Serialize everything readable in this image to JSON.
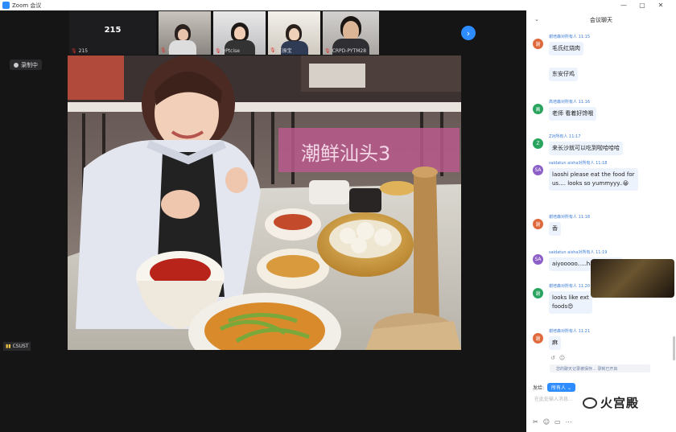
{
  "window": {
    "app_name": "Zoom 会议",
    "minimize": "—",
    "maximize": "▢",
    "close": "✕"
  },
  "recording": {
    "label": "录制中"
  },
  "thumbnails": [
    {
      "type": "number",
      "value": "215",
      "name": "215"
    },
    {
      "type": "person",
      "name": "金属选"
    },
    {
      "type": "person",
      "name": "yPtcise"
    },
    {
      "type": "person",
      "name": "王振宝"
    },
    {
      "type": "person",
      "name": "CRPD-PYTM28"
    }
  ],
  "main_video": {
    "speaker_name": "CSUST",
    "sign_text": "潮鲜汕头3"
  },
  "chat": {
    "title": "会议聊天",
    "messages": [
      {
        "avatar": "谢",
        "avatar_color": "#e0693c",
        "meta": "谢培森对所有人 11:15",
        "lines": [
          "毛氏红烧肉"
        ]
      },
      {
        "avatar": "",
        "avatar_color": "",
        "meta": "",
        "lines": [
          "东安仔鸡"
        ]
      },
      {
        "avatar": "高",
        "avatar_color": "#28a45e",
        "meta": "高培森对所有人 11:16",
        "lines": [
          "老师 看着好馋哦"
        ]
      },
      {
        "avatar": "Z",
        "avatar_color": "#28a45e",
        "meta": "Z对所有人 11:17",
        "lines": [
          "来长沙就可以吃到啦哈哈哈"
        ]
      },
      {
        "avatar": "SA",
        "avatar_color": "#8b5ec8",
        "meta": "saidatun aisha对所有人 11:18",
        "lines": [
          "laoshi please eat the food for",
          "us.... looks so yummyyy..😀"
        ]
      },
      {
        "avatar": "谢",
        "avatar_color": "#e0693c",
        "meta": "谢培森对所有人 11:18",
        "lines": [
          "香"
        ]
      },
      {
        "avatar": "SA",
        "avatar_color": "#8b5ec8",
        "meta": "saidatun aisha对所有人 11:19",
        "lines": [
          "aiyooooo.....haochiiiiiiiiii"
        ]
      },
      {
        "avatar": "谢",
        "avatar_color": "#28a45e",
        "meta": "谢培森对所有人 11:20",
        "lines": [
          "looks like ext",
          "foods😍"
        ]
      },
      {
        "avatar": "谢",
        "avatar_color": "#e0693c",
        "meta": "谢培森对所有人 11:21",
        "lines": [
          "麻"
        ]
      }
    ],
    "system_notice": "您的聊天记录被保存... 录制已开启",
    "send_to_label": "发给:",
    "send_to_value": "所有人 ⌄",
    "input_placeholder": "在此处输入消息...",
    "watermark": "火宫殿"
  }
}
